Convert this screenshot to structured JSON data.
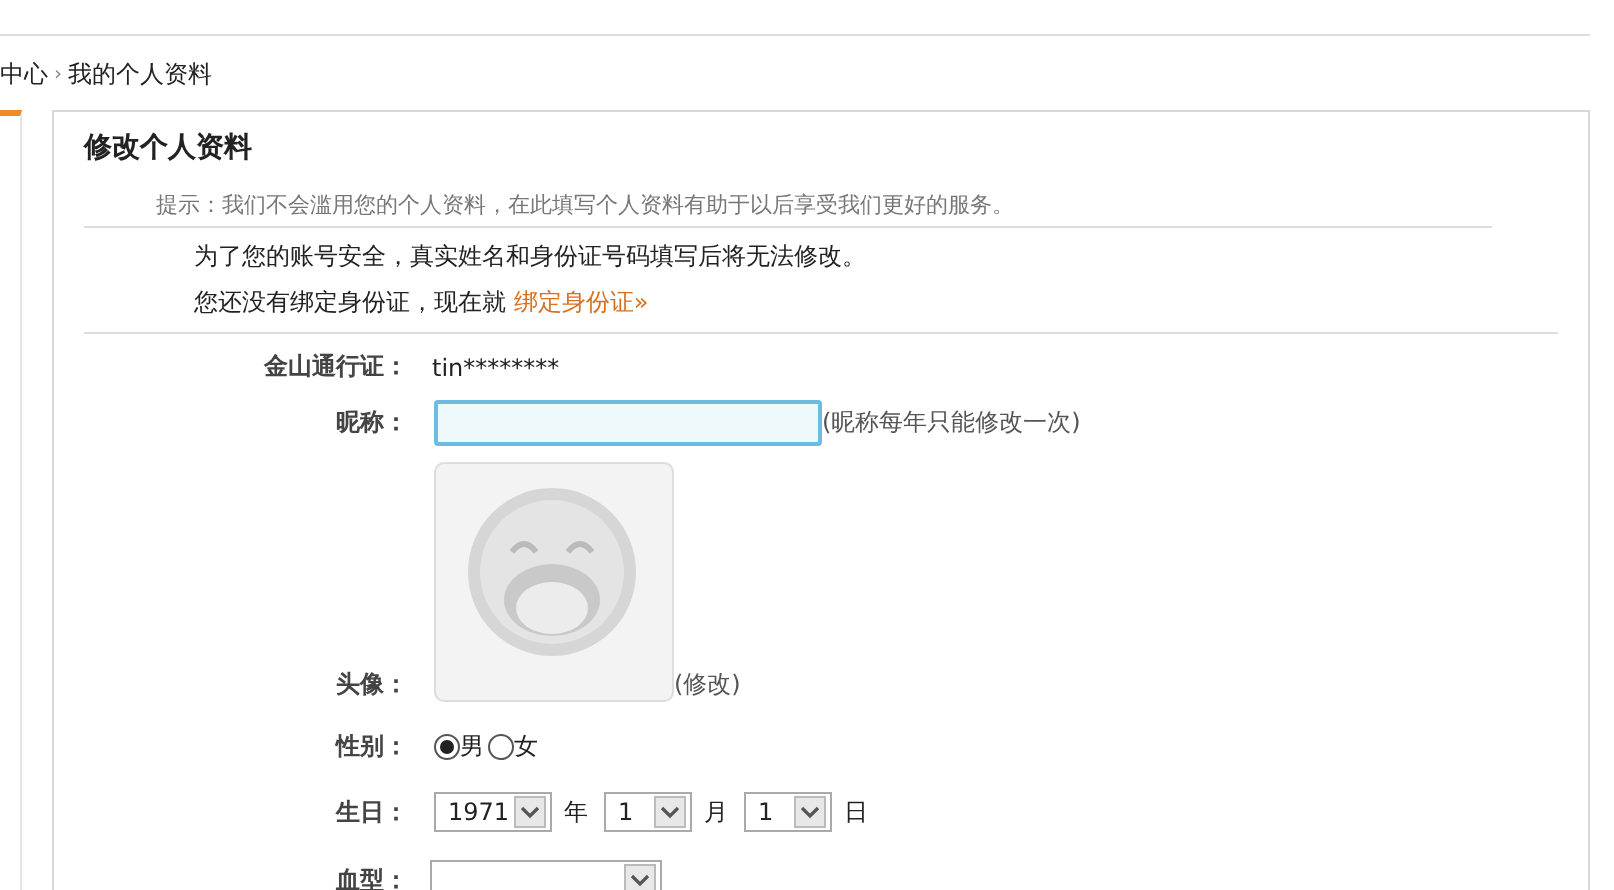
{
  "breadcrumb": {
    "parent": "中心",
    "separator": "›",
    "current": "我的个人资料"
  },
  "panel": {
    "title": "修改个人资料",
    "hint": "提示：我们不会滥用您的个人资料，在此填写个人资料有助于以后享受我们更好的服务。",
    "notice": "为了您的账号安全，真实姓名和身份证号码填写后将无法修改。",
    "bind_text": "您还没有绑定身份证，现在就",
    "bind_link": "绑定身份证»"
  },
  "form": [
    {
      "kind": "text",
      "label": "金山通行证：",
      "value": "tin********"
    },
    {
      "kind": "input",
      "label": "昵称：",
      "note": "(昵称每年只能修改一次)"
    },
    {
      "label": "头像：",
      "note": "(修改)"
    },
    {
      "kind": "radio",
      "label": "性别：",
      "options": [
        {
          "label": "男",
          "selected": true
        },
        {
          "label": "女",
          "selected": false
        }
      ]
    },
    {
      "kind": "date",
      "label": "生日：",
      "parts": [
        {
          "value": "1971",
          "unit": "年"
        },
        {
          "value": "1",
          "unit": "月"
        },
        {
          "value": "1",
          "unit": "日"
        }
      ]
    },
    {
      "kind": "select",
      "label": "血型："
    }
  ]
}
